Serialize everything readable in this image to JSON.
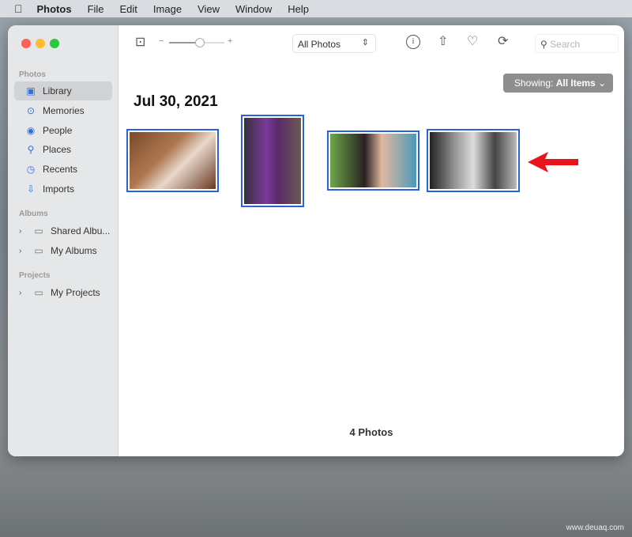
{
  "menubar": {
    "items": [
      "Photos",
      "File",
      "Edit",
      "Image",
      "View",
      "Window",
      "Help"
    ]
  },
  "sidebar": {
    "section_photos": "Photos",
    "photos_items": [
      {
        "label": "Library",
        "icon": "library-icon",
        "selected": true
      },
      {
        "label": "Memories",
        "icon": "memories-icon"
      },
      {
        "label": "People",
        "icon": "people-icon"
      },
      {
        "label": "Places",
        "icon": "places-icon"
      },
      {
        "label": "Recents",
        "icon": "recents-icon"
      },
      {
        "label": "Imports",
        "icon": "imports-icon"
      }
    ],
    "section_albums": "Albums",
    "album_items": [
      {
        "label": "Shared Albu..."
      },
      {
        "label": "My Albums"
      }
    ],
    "section_projects": "Projects",
    "project_items": [
      {
        "label": "My Projects"
      }
    ]
  },
  "toolbar": {
    "view_select": "All Photos",
    "zoom_minus": "−",
    "zoom_plus": "+",
    "zoom_level": 0.55,
    "search_placeholder": "Search"
  },
  "filter": {
    "prefix": "Showing:",
    "value": "All Items"
  },
  "content": {
    "date": "Jul 30, 2021",
    "count": "4 Photos"
  },
  "colors": {
    "accent": "#2a63d8",
    "arrow": "#e8141b"
  },
  "watermark": "www.deuaq.com"
}
